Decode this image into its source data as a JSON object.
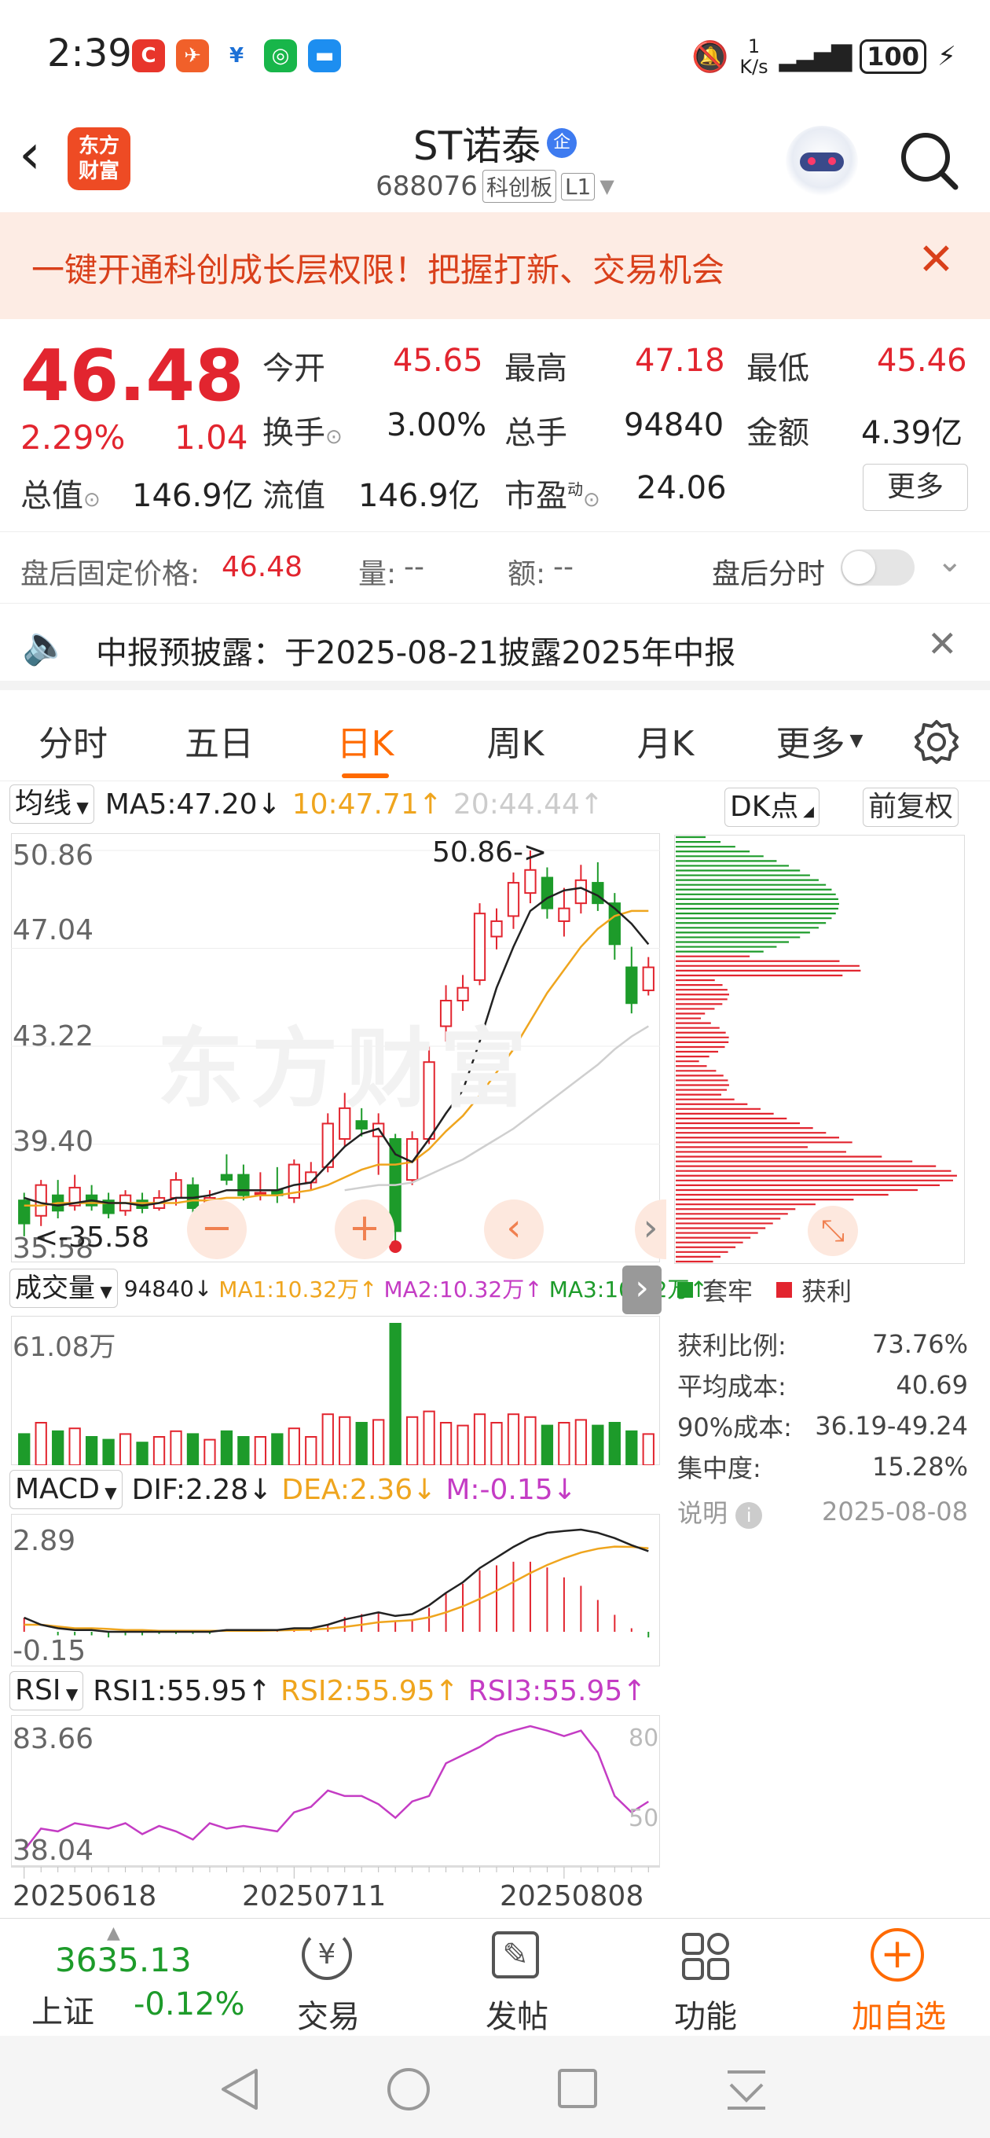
{
  "status_bar": {
    "time": "2:39",
    "net_speed_top": "1",
    "net_speed_unit": "K/s",
    "battery": "100"
  },
  "header": {
    "brand_line1": "东方",
    "brand_line2": "财富",
    "stock_name": "ST诺泰",
    "badge": "企",
    "code": "688076",
    "board": "科创板",
    "level": "L1"
  },
  "banner": {
    "text": "一键开通科创成长层权限！把握打新、交易机会"
  },
  "quote": {
    "price": "46.48",
    "change_pct": "2.29%",
    "change": "1.04",
    "open_label": "今开",
    "open": "45.65",
    "high_label": "最高",
    "high": "47.18",
    "low_label": "最低",
    "low": "45.46",
    "turnover_label": "换手",
    "turnover": "3.00%",
    "volume_label": "总手",
    "volume": "94840",
    "amount_label": "金额",
    "amount": "4.39亿",
    "mktcap_label": "总值",
    "mktcap": "146.9亿",
    "float_label": "流值",
    "float_cap": "146.9亿",
    "pe_label": "市盈",
    "pe_sup": "动",
    "pe": "24.06",
    "more": "更多"
  },
  "after_hours": {
    "price_label": "盘后固定价格:",
    "price": "46.48",
    "vol_label": "量:",
    "vol": "--",
    "amt_label": "额:",
    "amt": "--",
    "timeshare_label": "盘后分时"
  },
  "notice": {
    "text": "中报预披露：于2025-08-21披露2025年中报"
  },
  "tabs": [
    {
      "label": "分时"
    },
    {
      "label": "五日"
    },
    {
      "label": "日K"
    },
    {
      "label": "周K"
    },
    {
      "label": "月K"
    },
    {
      "label": "更多"
    }
  ],
  "kline": {
    "indicator": "均线",
    "ma5": "MA5:47.20",
    "ma5_arrow": "↓",
    "ma10": "10:47.71",
    "ma10_arrow": "↑",
    "ma20": "20:44.44",
    "ma20_arrow": "↑",
    "dk": "DK点",
    "adjust": "前复权",
    "y_labels": [
      "50.86",
      "47.04",
      "43.22",
      "39.40",
      "35.58"
    ],
    "max_note": "50.86->",
    "min_note": "<-35.58",
    "watermark": "东方财富"
  },
  "volume": {
    "indicator": "成交量",
    "vol": "94840",
    "vol_arrow": "↓",
    "ma1": "MA1:10.32万",
    "ma1_arrow": "↑",
    "ma2": "MA2:10.32万",
    "ma2_arrow": "↑",
    "ma3": "MA3:10.32万",
    "ma3_arrow": "↑",
    "max": "61.08万"
  },
  "macd": {
    "indicator": "MACD",
    "dif": "DIF:2.28",
    "dif_arrow": "↓",
    "dea": "DEA:2.36",
    "dea_arrow": "↓",
    "m": "M:-0.15",
    "m_arrow": "↓",
    "y_top": "2.89",
    "y_bottom": "-0.15"
  },
  "rsi": {
    "indicator": "RSI",
    "rsi1": "RSI1:55.95",
    "rsi1_arrow": "↑",
    "rsi2": "RSI2:55.95",
    "rsi2_arrow": "↑",
    "rsi3": "RSI3:55.95",
    "rsi3_arrow": "↑",
    "y_top": "83.66",
    "y_bottom": "38.04",
    "mark_top": "80",
    "mark_bottom": "50"
  },
  "x_dates": [
    "20250618",
    "20250711",
    "20250808"
  ],
  "chip_dist": {
    "legend_trapped": "套牢",
    "legend_profit": "获利",
    "rows": [
      {
        "label": "获利比例:",
        "value": "73.76%"
      },
      {
        "label": "平均成本:",
        "value": "40.69"
      },
      {
        "label": "90%成本:",
        "value": "36.19-49.24"
      },
      {
        "label": "集中度:",
        "value": "15.28%"
      }
    ],
    "note_label": "说明",
    "date": "2025-08-08"
  },
  "bottom": {
    "index_value": "3635.13",
    "index_name": "上证",
    "index_change": "-0.12%",
    "trade": "交易",
    "post": "发帖",
    "func": "功能",
    "add": "加自选"
  },
  "colors": {
    "red": "#e2252f",
    "green": "#1d9b2a",
    "accent": "#ff6a00"
  },
  "chart_data": {
    "type": "candlestick",
    "ylim": [
      35.58,
      50.86
    ],
    "candles": [
      {
        "o": 37.2,
        "c": 36.3,
        "h": 37.5,
        "l": 35.8
      },
      {
        "o": 36.6,
        "c": 37.8,
        "h": 38.0,
        "l": 36.2
      },
      {
        "o": 37.4,
        "c": 36.8,
        "h": 38.0,
        "l": 36.5
      },
      {
        "o": 37.0,
        "c": 37.7,
        "h": 38.2,
        "l": 36.8
      },
      {
        "o": 37.4,
        "c": 37.0,
        "h": 37.8,
        "l": 36.8
      },
      {
        "o": 37.2,
        "c": 36.7,
        "h": 37.5,
        "l": 36.5
      },
      {
        "o": 36.8,
        "c": 37.4,
        "h": 37.6,
        "l": 36.6
      },
      {
        "o": 37.2,
        "c": 36.9,
        "h": 37.5,
        "l": 36.7
      },
      {
        "o": 36.9,
        "c": 37.3,
        "h": 37.6,
        "l": 36.8
      },
      {
        "o": 37.3,
        "c": 38.0,
        "h": 38.3,
        "l": 37.0
      },
      {
        "o": 37.8,
        "c": 36.9,
        "h": 38.1,
        "l": 36.7
      },
      {
        "o": 36.9,
        "c": 37.3,
        "h": 37.6,
        "l": 36.8
      },
      {
        "o": 38.2,
        "c": 38.0,
        "h": 39.0,
        "l": 37.8
      },
      {
        "o": 38.2,
        "c": 37.4,
        "h": 38.6,
        "l": 37.2
      },
      {
        "o": 37.5,
        "c": 37.5,
        "h": 38.3,
        "l": 37.2
      },
      {
        "o": 37.6,
        "c": 37.4,
        "h": 38.5,
        "l": 37.1
      },
      {
        "o": 37.3,
        "c": 38.6,
        "h": 38.8,
        "l": 37.1
      },
      {
        "o": 37.9,
        "c": 38.3,
        "h": 38.7,
        "l": 37.6
      },
      {
        "o": 38.5,
        "c": 40.2,
        "h": 40.6,
        "l": 38.3
      },
      {
        "o": 39.6,
        "c": 40.8,
        "h": 41.4,
        "l": 39.3
      },
      {
        "o": 40.3,
        "c": 40.0,
        "h": 40.8,
        "l": 39.7
      },
      {
        "o": 39.7,
        "c": 40.2,
        "h": 40.6,
        "l": 38.2
      },
      {
        "o": 39.6,
        "c": 36.0,
        "h": 39.8,
        "l": 35.58
      },
      {
        "o": 38.0,
        "c": 39.6,
        "h": 39.9,
        "l": 37.8
      },
      {
        "o": 39.6,
        "c": 42.6,
        "h": 43.2,
        "l": 39.4
      },
      {
        "o": 44.0,
        "c": 45.0,
        "h": 45.6,
        "l": 43.4
      },
      {
        "o": 45.0,
        "c": 45.5,
        "h": 46.0,
        "l": 44.6
      },
      {
        "o": 45.8,
        "c": 48.4,
        "h": 48.8,
        "l": 45.6
      },
      {
        "o": 47.5,
        "c": 48.1,
        "h": 48.6,
        "l": 47.0
      },
      {
        "o": 48.3,
        "c": 49.6,
        "h": 50.0,
        "l": 47.8
      },
      {
        "o": 49.2,
        "c": 50.1,
        "h": 50.86,
        "l": 48.8
      },
      {
        "o": 49.8,
        "c": 48.6,
        "h": 50.2,
        "l": 48.2
      },
      {
        "o": 48.1,
        "c": 48.6,
        "h": 49.4,
        "l": 47.5
      },
      {
        "o": 48.8,
        "c": 49.7,
        "h": 50.3,
        "l": 48.4
      },
      {
        "o": 49.6,
        "c": 48.8,
        "h": 50.4,
        "l": 48.5
      },
      {
        "o": 48.8,
        "c": 47.2,
        "h": 49.2,
        "l": 46.6
      },
      {
        "o": 46.3,
        "c": 44.9,
        "h": 47.1,
        "l": 44.5
      },
      {
        "o": 45.4,
        "c": 46.3,
        "h": 46.7,
        "l": 45.2
      }
    ],
    "ma5": [
      37.3,
      37.1,
      37.0,
      37.1,
      37.2,
      37.1,
      37.1,
      37.0,
      37.1,
      37.3,
      37.3,
      37.4,
      37.6,
      37.6,
      37.6,
      37.6,
      37.8,
      37.9,
      38.6,
      39.3,
      39.8,
      40.0,
      39.0,
      38.7,
      39.6,
      40.6,
      41.5,
      43.4,
      45.5,
      47.1,
      48.5,
      49.0,
      49.3,
      49.4,
      49.1,
      48.6,
      48.0,
      47.2
    ],
    "ma10": [
      37.0,
      37.0,
      37.1,
      37.1,
      37.1,
      37.1,
      37.1,
      37.1,
      37.1,
      37.1,
      37.2,
      37.2,
      37.3,
      37.3,
      37.4,
      37.4,
      37.5,
      37.6,
      37.8,
      38.1,
      38.4,
      38.6,
      38.6,
      38.7,
      39.2,
      39.9,
      40.5,
      41.3,
      42.2,
      43.1,
      44.2,
      45.3,
      46.2,
      47.1,
      47.8,
      48.3,
      48.5,
      48.5
    ],
    "ma20": [
      null,
      null,
      null,
      null,
      null,
      null,
      null,
      null,
      null,
      null,
      null,
      null,
      null,
      null,
      null,
      null,
      null,
      null,
      null,
      37.6,
      37.7,
      37.8,
      37.8,
      37.9,
      38.2,
      38.5,
      38.8,
      39.2,
      39.6,
      40.0,
      40.5,
      41.0,
      41.5,
      42.0,
      42.5,
      43.1,
      43.6,
      44.0
    ],
    "volume": [
      22,
      30,
      24,
      26,
      20,
      18,
      22,
      16,
      20,
      24,
      22,
      18,
      24,
      20,
      20,
      22,
      26,
      20,
      36,
      34,
      30,
      32,
      100,
      34,
      38,
      30,
      28,
      36,
      30,
      36,
      34,
      28,
      30,
      32,
      28,
      30,
      24,
      22
    ],
    "dif": [
      0.4,
      0.2,
      0.1,
      0.05,
      0.05,
      0.0,
      0.0,
      0.0,
      0.0,
      0.0,
      0.0,
      0.0,
      0.05,
      0.05,
      0.05,
      0.05,
      0.1,
      0.1,
      0.2,
      0.35,
      0.45,
      0.55,
      0.45,
      0.5,
      0.75,
      1.1,
      1.4,
      1.8,
      2.1,
      2.4,
      2.65,
      2.8,
      2.85,
      2.89,
      2.8,
      2.65,
      2.45,
      2.28
    ],
    "dea": [
      0.2,
      0.2,
      0.15,
      0.1,
      0.1,
      0.08,
      0.05,
      0.05,
      0.03,
      0.03,
      0.03,
      0.03,
      0.03,
      0.03,
      0.03,
      0.04,
      0.05,
      0.06,
      0.09,
      0.14,
      0.2,
      0.27,
      0.3,
      0.33,
      0.41,
      0.55,
      0.72,
      0.93,
      1.16,
      1.41,
      1.66,
      1.89,
      2.08,
      2.24,
      2.35,
      2.41,
      2.4,
      2.36
    ],
    "rsi": [
      38.04,
      46,
      45,
      48,
      47,
      46,
      48,
      44,
      47,
      45,
      42,
      48,
      46,
      47,
      46,
      45,
      52,
      54,
      60,
      58,
      58,
      55,
      50,
      56,
      58,
      70,
      73,
      76,
      80,
      82,
      83.66,
      82,
      80,
      82,
      74,
      58,
      52,
      55.95
    ]
  }
}
